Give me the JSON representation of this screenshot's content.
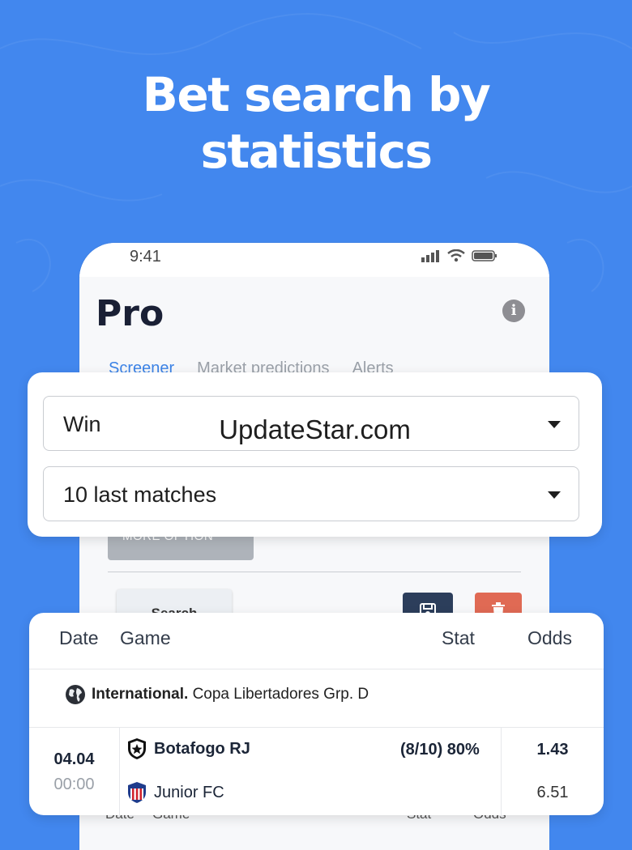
{
  "headline": {
    "line1": "Bet search by",
    "line2": "statistics"
  },
  "status_bar": {
    "time": "9:41"
  },
  "app": {
    "title": "Pro",
    "info_icon": "i"
  },
  "tabs": [
    "Screener",
    "Market predictions",
    "Alerts"
  ],
  "filters": {
    "market": "Win",
    "range": "10 last matches",
    "watermark": "UpdateStar.com"
  },
  "more_option_label": "MORE OPTION",
  "search_label": "Search",
  "results": {
    "headers": {
      "date": "Date",
      "game": "Game",
      "stat": "Stat",
      "odds": "Odds"
    },
    "league": {
      "region": "International.",
      "name": "Copa Libertadores Grp. D"
    },
    "match": {
      "date": "04.04",
      "time": "00:00",
      "home": "Botafogo RJ",
      "away": "Junior FC",
      "stat": "(8/10) 80%",
      "odds_home": "1.43",
      "odds_away": "6.51"
    }
  },
  "colors": {
    "background": "#4287ee",
    "accent": "#3c83e6",
    "save": "#2c3e5b",
    "delete": "#e06a54"
  }
}
